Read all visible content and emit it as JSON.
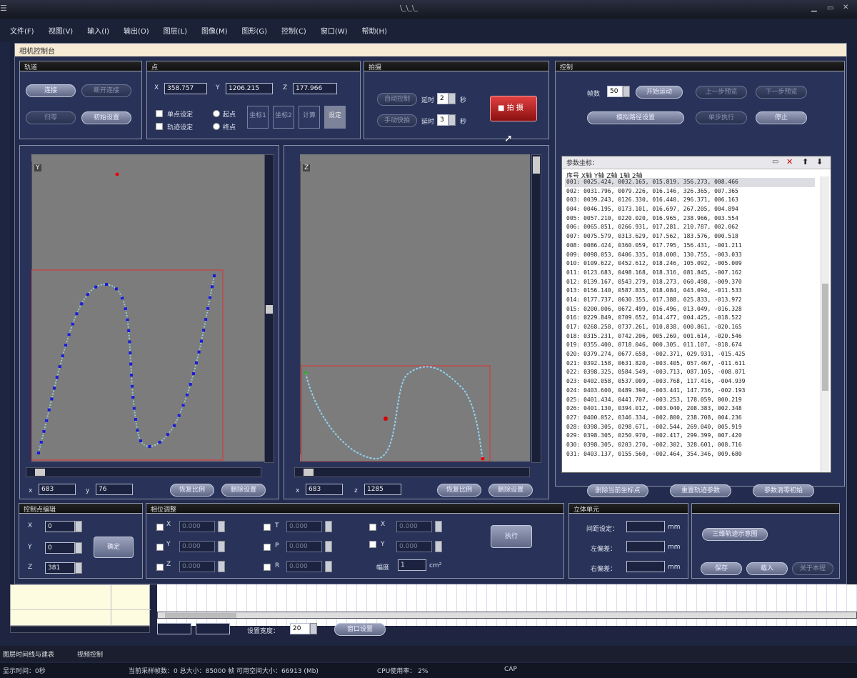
{
  "window": {
    "title": "\\_\\_\\_"
  },
  "menu": [
    "文件(F)",
    "视图(V)",
    "输入(I)",
    "输出(O)",
    "图层(L)",
    "图像(M)",
    "图形(G)",
    "控制(C)",
    "窗口(W)",
    "帮助(H)"
  ],
  "dialog_title": "相机控制台",
  "track": {
    "header": "轨道",
    "buttons": [
      "连接",
      "断开连接",
      "归零",
      "初始设置"
    ]
  },
  "point": {
    "header": "点",
    "x_label": "X",
    "x_value": "358.757",
    "y_label": "Y",
    "y_value": "1206.215",
    "z_label": "Z",
    "z_value": "177.966",
    "single_label": "单点设定",
    "track_label": "轨迹设定",
    "start_label": "起点",
    "end_label": "终点",
    "buttons": [
      "坐标1",
      "坐标2",
      "计算",
      "设定"
    ]
  },
  "shoot": {
    "header": "拍摄",
    "auto_label": "自动控制",
    "delay1_label": "延时",
    "delay1_value": "2",
    "sec1": "秒",
    "manual_label": "手动快拍",
    "delay2_label": "延时",
    "delay2_value": "3",
    "sec2": "秒",
    "shoot_button": "拍 摄"
  },
  "control": {
    "header": "控制",
    "frames_label": "帧数",
    "frames_value": "50",
    "buttons": [
      "开始运动",
      "上一步预览",
      "下一步预览",
      "模拟路径设置",
      "单步执行",
      "停止"
    ]
  },
  "plotL": {
    "axis_label": "Y",
    "x_label": "x",
    "x_value": "683",
    "y_label": "y",
    "y_value": "76",
    "btn_fit": "恢复比例",
    "btn_del": "删除设置"
  },
  "plotR": {
    "axis_label": "Z",
    "x_label": "x",
    "x_value": "683",
    "z_label": "z",
    "z_value": "1285",
    "btn_fit": "恢复比例",
    "btn_del": "删除设置"
  },
  "params": {
    "title": "参数坐标：",
    "columns": "序号  X轴  Y轴  Z轴  1轴  2轴",
    "rows": [
      "001: 0025.424, 0032.165, 015.819, 356.273, 008.466",
      "002: 0031.796, 0079.226, 016.146, 326.365, 007.365",
      "003: 0039.243, 0126.330, 016.440, 296.371, 006.163",
      "004: 0046.195, 0173.101, 016.697, 267.205, 004.894",
      "005: 0057.210, 0220.020, 016.965, 238.966, 003.554",
      "006: 0065.051, 0266.931, 017.281, 210.787, 002.062",
      "007: 0075.579, 0313.629, 017.562, 183.576, 000.518",
      "008: 0086.424, 0360.059, 017.795, 156.431, -001.211",
      "009: 0098.053, 0406.335, 018.008, 130.755, -003.033",
      "010: 0109.622, 0452.612, 018.246, 105.092, -005.009",
      "011: 0123.683, 0498.168, 018.316, 081.845, -007.162",
      "012: 0139.167, 0543.279, 018.273, 060.498, -009.370",
      "013: 0156.140, 0587.835, 018.084, 043.094, -011.533",
      "014: 0177.737, 0630.355, 017.388, 025.833, -013.972",
      "015: 0200.006, 0672.499, 016.496, 013.049, -016.328",
      "016: 0229.849, 0709.652, 014.477, 004.425, -018.522",
      "017: 0268.258, 0737.261, 010.838, 000.861, -020.165",
      "018: 0315.231, 0742.206, 005.269, 001.614, -020.546",
      "019: 0355.400, 0718.046, 000.305, 011.107, -018.674",
      "020: 0379.274, 0677.658, -002.371, 029.931, -015.425",
      "021: 0392.158, 0631.820, -003.405, 057.467, -011.611",
      "022: 0398.325, 0584.549, -003.713, 087.105, -008.071",
      "023: 0402.058, 0537.009, -003.768, 117.416, -004.939",
      "024: 0403.600, 0489.390, -003.441, 147.736, -002.193",
      "025: 0401.434, 0441.707, -003.253, 178.059, 000.219",
      "026: 0401.130, 0394.012, -003.040, 208.383, 002.348",
      "027: 0400.052, 0346.334, -002.800, 238.708, 004.236",
      "028: 0398.305, 0298.671, -002.544, 269.040, 005.919",
      "029: 0398.305, 0250.970, -002.417, 299.399, 007.420",
      "030: 0398.305, 0203.270, -002.302, 328.601, 008.716",
      "031: 0403.137, 0155.560, -002.464, 354.346, 009.680"
    ],
    "buttons": [
      "删除当前坐标点",
      "重置轨迹参数",
      "参数清零初始"
    ]
  },
  "editor": {
    "header": "控制点编辑",
    "x_label": "X",
    "x_value": "0",
    "y_label": "Y",
    "y_value": "0",
    "z_label": "Z",
    "z_value": "381",
    "confirm": "确定"
  },
  "adjust": {
    "header": "相位调整",
    "fields": [
      {
        "l": "X",
        "v": "0.000"
      },
      {
        "l": "Y",
        "v": "0.000"
      },
      {
        "l": "Z",
        "v": "0.000"
      },
      {
        "l": "T",
        "v": "0.000"
      },
      {
        "l": "P",
        "v": "0.000"
      },
      {
        "l": "R",
        "v": "0.000"
      },
      {
        "l": "X",
        "v": "0.000"
      },
      {
        "l": "Y",
        "v": "0.000"
      }
    ],
    "range_label": "幅度",
    "range_value": "1",
    "unit": "cm²",
    "exec": "执行"
  },
  "stereo": {
    "header": "立体单元",
    "dist_label": "间距设定：",
    "unit": "mm",
    "left_label": "左偏差：",
    "right_label": "右偏差："
  },
  "misc": {
    "btn_3d": "三维轨迹示意图",
    "save": "保存",
    "load": "载入",
    "extra": "关于本程"
  },
  "lower": {
    "set_width_label": "设置宽度：",
    "set_width_value": "20",
    "set_btn": "窗口设置"
  },
  "tabs": [
    "图层时间线与建表",
    "视频控制"
  ],
  "status": {
    "left": "显示时间：0秒",
    "mem": "当前采样帧数：0   总大小：85000 帧   可用空间大小：66913 (Mb)",
    "cpu": "CPU使用率： 2%",
    "cap": "CAP"
  }
}
